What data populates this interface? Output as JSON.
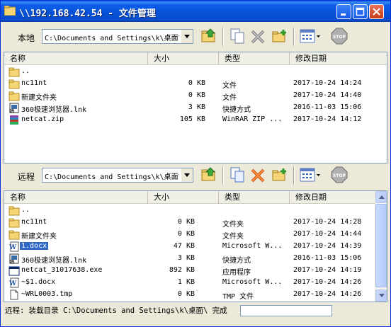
{
  "window": {
    "title": "\\\\192.168.42.54 - 文件管理"
  },
  "local": {
    "label": "本地",
    "path": "C:\\Documents and Settings\\k\\桌面\\",
    "columns": [
      "名称",
      "大小",
      "类型",
      "修改日期"
    ],
    "rows": [
      {
        "icon": "folder-icon",
        "name": "..",
        "size": "",
        "type": "",
        "date": ""
      },
      {
        "icon": "folder-icon",
        "name": "nc11nt",
        "size": "0 KB",
        "type": "文件",
        "date": "2017-10-24 14:24"
      },
      {
        "icon": "folder-icon",
        "name": "新建文件夹",
        "size": "0 KB",
        "type": "文件",
        "date": "2017-10-24 14:40"
      },
      {
        "icon": "shortcut-icon",
        "name": "360极速浏览器.lnk",
        "size": "3 KB",
        "type": "快捷方式",
        "date": "2016-11-03 15:06"
      },
      {
        "icon": "archive-icon",
        "name": "netcat.zip",
        "size": "105 KB",
        "type": "WinRAR ZIP ...",
        "date": "2017-10-24 14:12"
      }
    ]
  },
  "remote": {
    "label": "远程",
    "path": "C:\\Documents and Settings\\k\\桌面\\",
    "columns": [
      "名称",
      "大小",
      "类型",
      "修改日期"
    ],
    "rows": [
      {
        "icon": "folder-icon",
        "name": "..",
        "size": "",
        "type": "",
        "date": ""
      },
      {
        "icon": "folder-icon",
        "name": "nc11nt",
        "size": "0 KB",
        "type": "文件夹",
        "date": "2017-10-24 14:28"
      },
      {
        "icon": "folder-icon",
        "name": "新建文件夹",
        "size": "0 KB",
        "type": "文件夹",
        "date": "2017-10-24 14:44"
      },
      {
        "icon": "word-doc-icon",
        "name": "1.docx",
        "size": "47 KB",
        "type": "Microsoft W...",
        "date": "2017-10-24 14:39",
        "selected": true
      },
      {
        "icon": "shortcut-icon",
        "name": "360极速浏览器.lnk",
        "size": "3 KB",
        "type": "快捷方式",
        "date": "2016-11-03 15:06"
      },
      {
        "icon": "exe-icon",
        "name": "netcat_31017638.exe",
        "size": "892 KB",
        "type": "应用程序",
        "date": "2017-10-24 14:19"
      },
      {
        "icon": "word-doc-icon",
        "name": "~$1.docx",
        "size": "1 KB",
        "type": "Microsoft W...",
        "date": "2017-10-24 14:26"
      },
      {
        "icon": "tmp-file-icon",
        "name": "~WRL0003.tmp",
        "size": "0 KB",
        "type": "TMP 文件",
        "date": "2017-10-24 14:26"
      }
    ]
  },
  "status": {
    "text": "远程: 装载目录 C:\\Documents and Settings\\k\\桌面\\ 完成"
  },
  "colors": {
    "titlebar": "#0551d8",
    "selection": "#316ac5"
  }
}
